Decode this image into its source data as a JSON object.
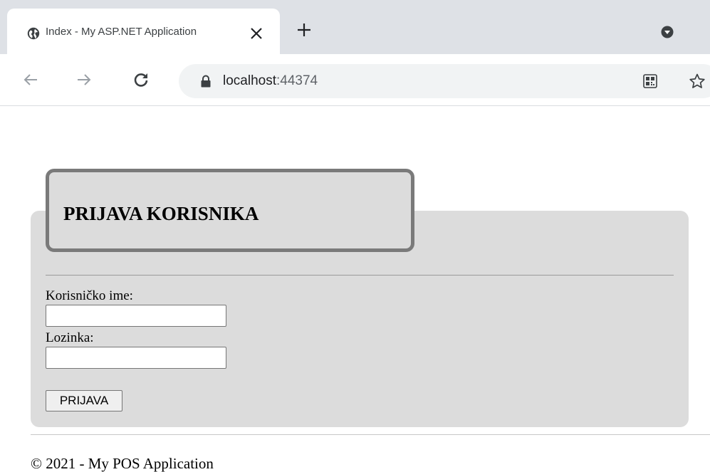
{
  "browser": {
    "tab": {
      "title": "Index - My ASP.NET Application",
      "icon": "globe-icon"
    },
    "icons": {
      "close_tab": "close-icon",
      "new_tab": "plus-icon",
      "profile": "profile-icon",
      "back": "back-arrow-icon",
      "forward": "forward-arrow-icon",
      "reload": "reload-icon",
      "lock": "lock-icon",
      "qr": "qr-code-icon",
      "bookmark": "star-icon"
    },
    "address": {
      "host": "localhost",
      "port": ":44374"
    },
    "colors": {
      "tabstrip": "#dee1e6",
      "omnibox": "#f1f3f4"
    }
  },
  "page": {
    "login": {
      "title": "PRIJAVA KORISNIKA",
      "username_label": "Korisničko ime:",
      "username_value": "",
      "password_label": "Lozinka:",
      "password_value": "",
      "submit_label": "PRIJAVA"
    },
    "footer": "© 2021 - My POS Application",
    "colors": {
      "panel": "#dcdcdc",
      "title_border": "#7a7a7a"
    }
  }
}
